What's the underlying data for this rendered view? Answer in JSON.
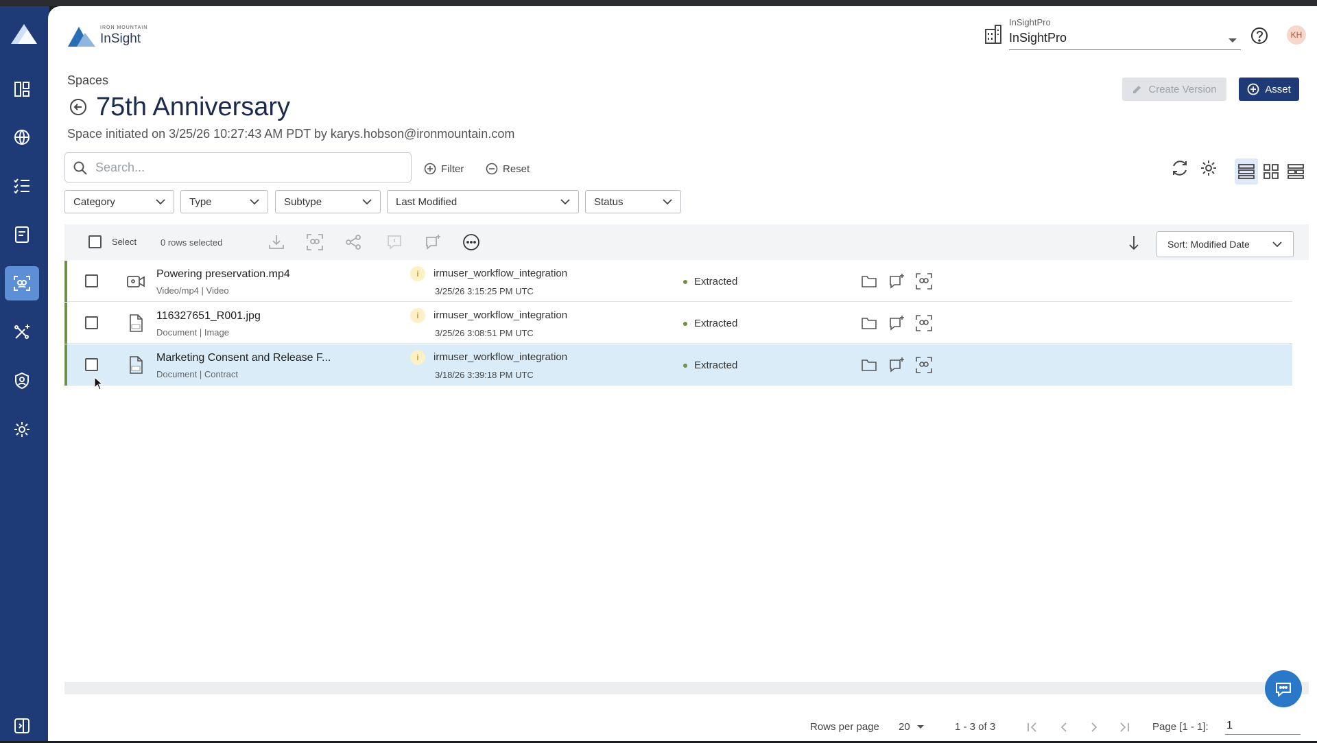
{
  "app": {
    "logo_small": "IRON MOUNTAIN",
    "logo_name": "InSight",
    "logo_mark": "®"
  },
  "tenant": {
    "label": "InSightPro",
    "value": "InSightPro"
  },
  "user": {
    "initials": "KH"
  },
  "page": {
    "breadcrumb": "Spaces",
    "title": "75th Anniversary",
    "subtitle": "Space initiated on 3/25/26 10:27:43 AM PDT by karys.hobson@ironmountain.com"
  },
  "actions": {
    "create_version": "Create Version",
    "asset": "Asset"
  },
  "search": {
    "placeholder": "Search..."
  },
  "filter_bar": {
    "filter": "Filter",
    "reset": "Reset"
  },
  "filters": [
    "Category",
    "Type",
    "Subtype",
    "Last Modified",
    "Status"
  ],
  "table_header": {
    "select_label": "Select",
    "rows_selected": "0 rows selected",
    "sort_label": "Sort: Modified Date"
  },
  "rows": [
    {
      "name": "Powering preservation.mp4",
      "meta_a": "Video/mp4",
      "meta_b": "Video",
      "file_icon": "video-icon",
      "badge": "i",
      "owner": "irmuser_workflow_integration",
      "date": "3/25/26 3:15:25 PM UTC",
      "status": "Extracted",
      "selected": false
    },
    {
      "name": "116327651_R001.jpg",
      "meta_a": "Document",
      "meta_b": "Image",
      "file_icon": "jpg-file-icon",
      "badge": "i",
      "owner": "irmuser_workflow_integration",
      "date": "3/25/26 3:08:51 PM UTC",
      "status": "Extracted",
      "selected": false
    },
    {
      "name": "Marketing Consent and Release F...",
      "meta_a": "Document",
      "meta_b": "Contract",
      "file_icon": "pdf-file-icon",
      "badge": "i",
      "owner": "irmuser_workflow_integration",
      "date": "3/18/26 3:39:18 PM UTC",
      "status": "Extracted",
      "selected": true
    }
  ],
  "pagination": {
    "rows_per_page_label": "Rows per page",
    "rows_per_page": "20",
    "range": "1 - 3 of 3",
    "page_label": "Page [1 - 1]:",
    "page_value": "1"
  },
  "colors": {
    "rail": "#1f3b77",
    "rail_active": "#5d8fd6",
    "primary": "#1f3b77",
    "status_ok": "#6f8f4a",
    "row_selected": "#d9ecf8",
    "fab": "#2a78c7"
  }
}
